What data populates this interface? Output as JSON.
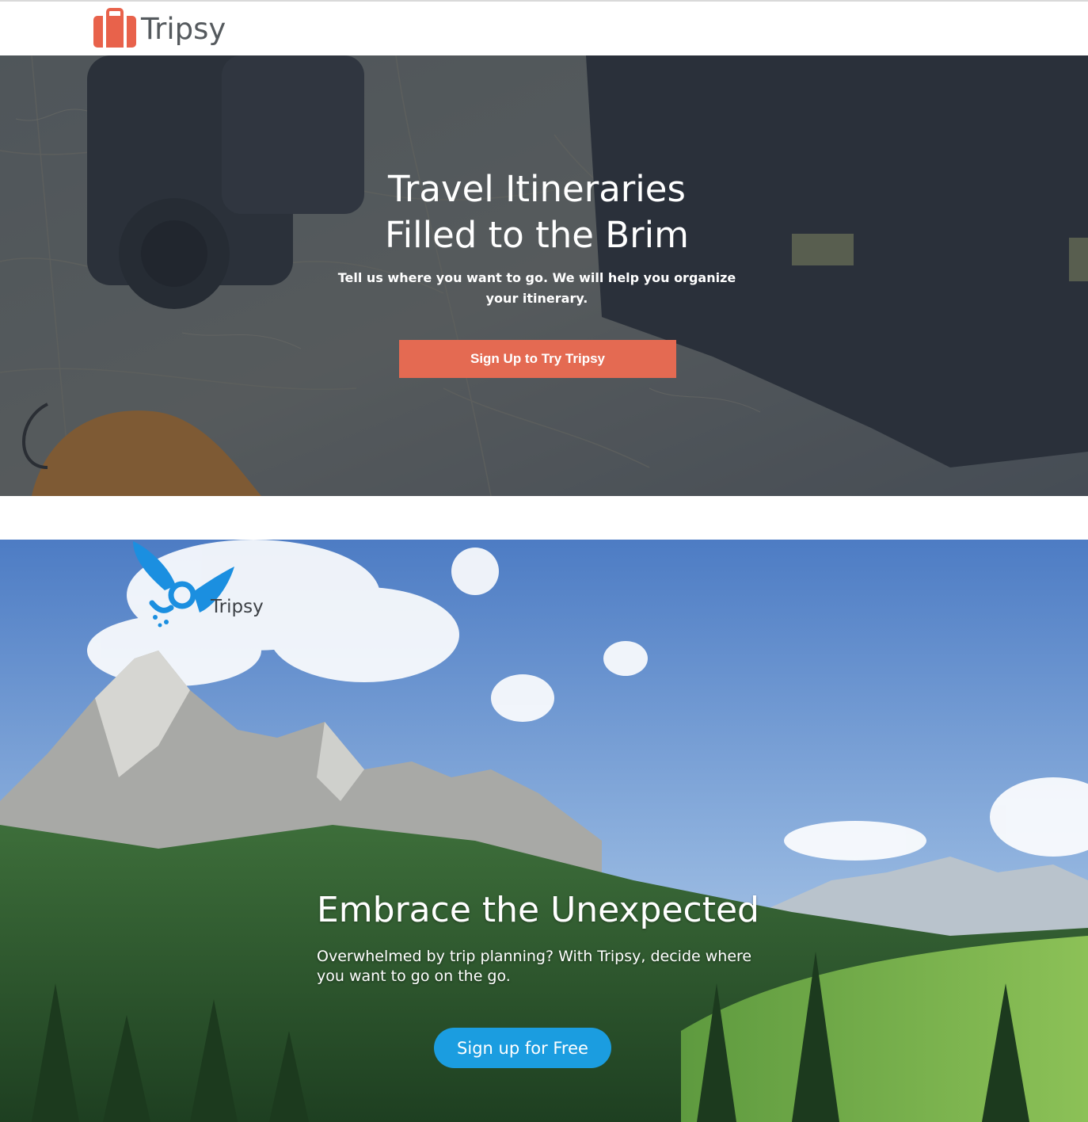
{
  "header": {
    "logo_text": "Tripsy",
    "logo_icon": "suitcase-icon",
    "accent_color": "#e8624b"
  },
  "hero1": {
    "title_line1": "Travel Itineraries",
    "title_line2": "Filled to the Brim",
    "subtitle": "Tell us where you want to go. We will help you organize your itinerary.",
    "cta_label": "Sign Up to Try Tripsy",
    "cta_color": "#e46a52"
  },
  "hero2": {
    "logo_text": "Tripsy",
    "logo_icon": "fairy-icon",
    "title": "Embrace the Unexpected",
    "subtitle": "Overwhelmed by trip planning? With Tripsy, decide where you want to go on the go.",
    "cta_label": "Sign up for Free",
    "cta_color": "#1b9de0"
  }
}
